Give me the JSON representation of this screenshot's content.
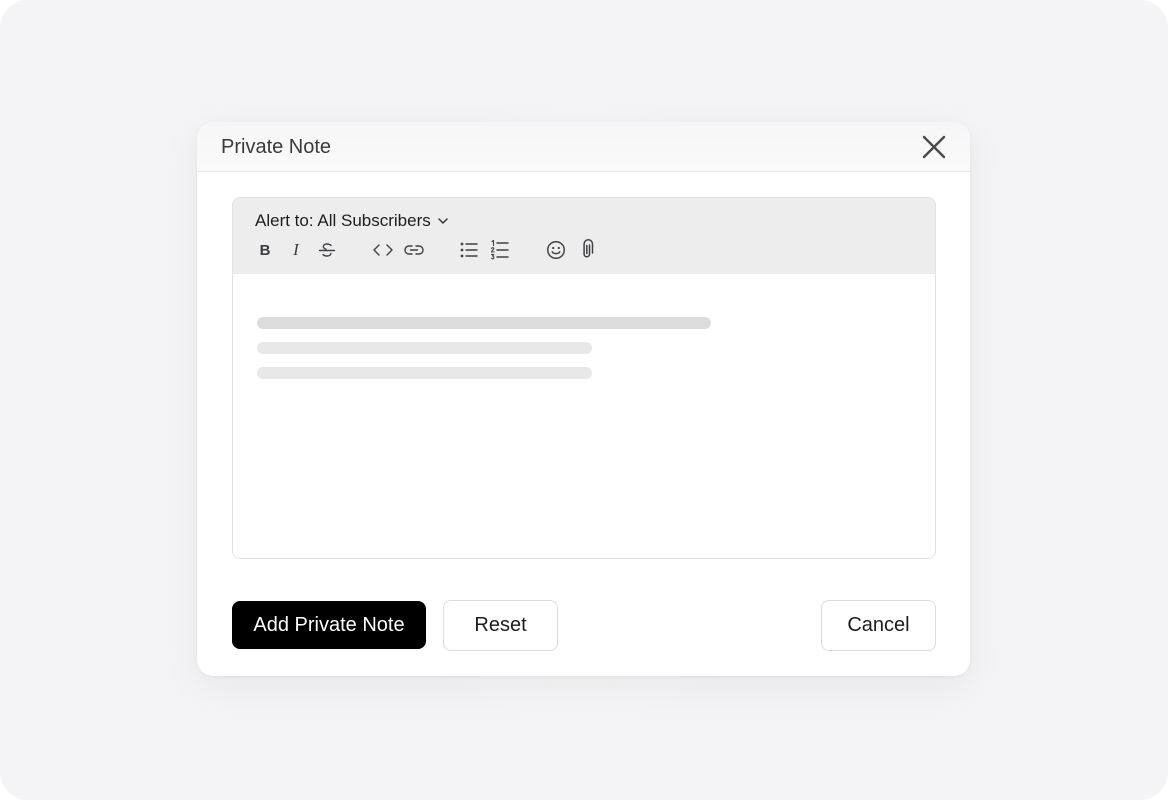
{
  "modal": {
    "title": "Private Note",
    "close_icon": "close-icon"
  },
  "editor": {
    "alert_label": "Alert to: All Subscribers",
    "alert_dropdown_icon": "chevron-down-icon",
    "toolbar": [
      {
        "name": "bold-icon",
        "label": "B"
      },
      {
        "name": "italic-icon",
        "label": "I"
      },
      {
        "name": "strikethrough-icon"
      },
      {
        "name": "code-icon"
      },
      {
        "name": "link-icon"
      },
      {
        "name": "bulleted-list-icon"
      },
      {
        "name": "numbered-list-icon"
      },
      {
        "name": "emoji-icon"
      },
      {
        "name": "attachment-icon"
      }
    ],
    "placeholder_lines": 3
  },
  "actions": {
    "primary_label": "Add Private Note",
    "reset_label": "Reset",
    "cancel_label": "Cancel"
  },
  "colors": {
    "background": "#f4f4f6",
    "primary_button": "#000000",
    "toolbar_bg": "#ededee",
    "skeleton_dark": "#dcdcdd",
    "skeleton_light": "#e8e8e9"
  }
}
